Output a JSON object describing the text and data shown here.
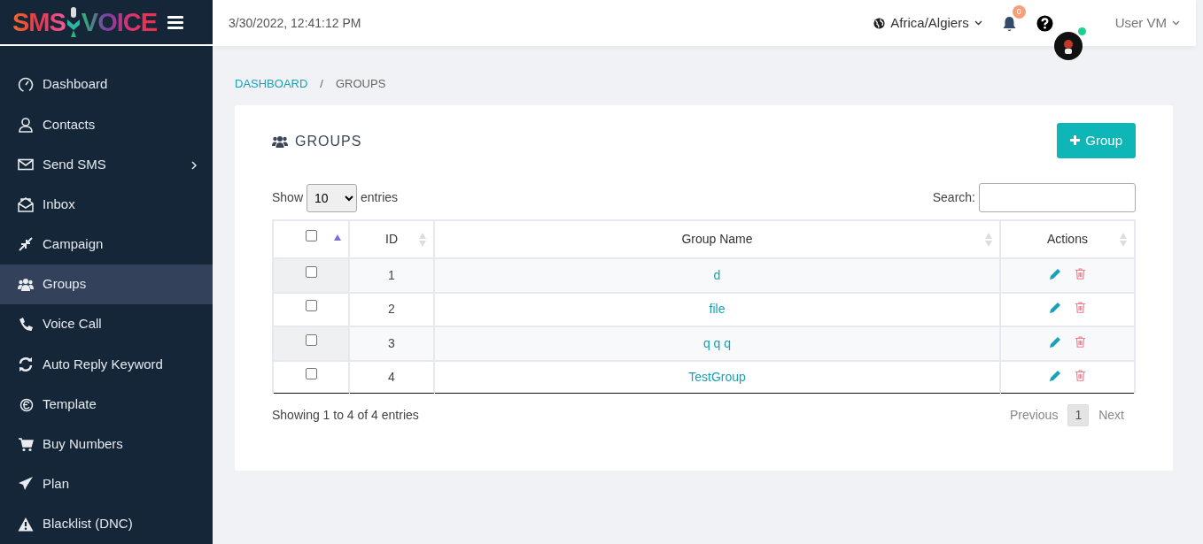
{
  "logo": {
    "left": "SMS",
    "right": "VOICE"
  },
  "topbar": {
    "datetime": "3/30/2022, 12:41:12 PM",
    "timezone": "Africa/Algiers",
    "notifications": "0",
    "user": "User VM",
    "online": true
  },
  "sidebar": {
    "items": [
      {
        "label": "Dashboard",
        "selected": false,
        "submenu": false
      },
      {
        "label": "Contacts",
        "selected": false,
        "submenu": false
      },
      {
        "label": "Send SMS",
        "selected": false,
        "submenu": true
      },
      {
        "label": "Inbox",
        "selected": false,
        "submenu": false
      },
      {
        "label": "Campaign",
        "selected": false,
        "submenu": false
      },
      {
        "label": "Groups",
        "selected": true,
        "submenu": false
      },
      {
        "label": "Voice Call",
        "selected": false,
        "submenu": false
      },
      {
        "label": "Auto Reply Keyword",
        "selected": false,
        "submenu": false
      },
      {
        "label": "Template",
        "selected": false,
        "submenu": false
      },
      {
        "label": "Buy Numbers",
        "selected": false,
        "submenu": false
      },
      {
        "label": "Plan",
        "selected": false,
        "submenu": false
      },
      {
        "label": "Blacklist (DNC)",
        "selected": false,
        "submenu": false
      }
    ]
  },
  "breadcrumb": [
    {
      "label": "DASHBOARD",
      "selected": false
    },
    {
      "separator": "/",
      "label": "GROUPS",
      "selected": true
    }
  ],
  "card": {
    "title": "GROUPS",
    "add_button": "Group",
    "length": {
      "before": "Show",
      "value": "10",
      "after": "entries"
    },
    "search": {
      "label": "Search:"
    },
    "table": {
      "columns": [
        {
          "kind": "checkbox",
          "checked": false,
          "sorted": true
        },
        {
          "kind": "text",
          "label": "ID",
          "sorted": false
        },
        {
          "kind": "text",
          "label": "Group Name",
          "sorted": false
        },
        {
          "kind": "text",
          "label": "Actions",
          "sorted": false
        }
      ],
      "rows": [
        {
          "checked": false,
          "id": "1",
          "name": "d"
        },
        {
          "checked": false,
          "id": "2",
          "name": "file"
        },
        {
          "checked": false,
          "id": "3",
          "name": "q q q"
        },
        {
          "checked": false,
          "id": "4",
          "name": "TestGroup"
        }
      ]
    },
    "info": "Showing 1 to 4 of 4 entries",
    "pagination": [
      {
        "label": "Previous",
        "selected": false,
        "disabled": true
      },
      {
        "label": "1",
        "selected": true,
        "disabled": false
      },
      {
        "label": "Next",
        "selected": false,
        "disabled": true
      }
    ]
  }
}
